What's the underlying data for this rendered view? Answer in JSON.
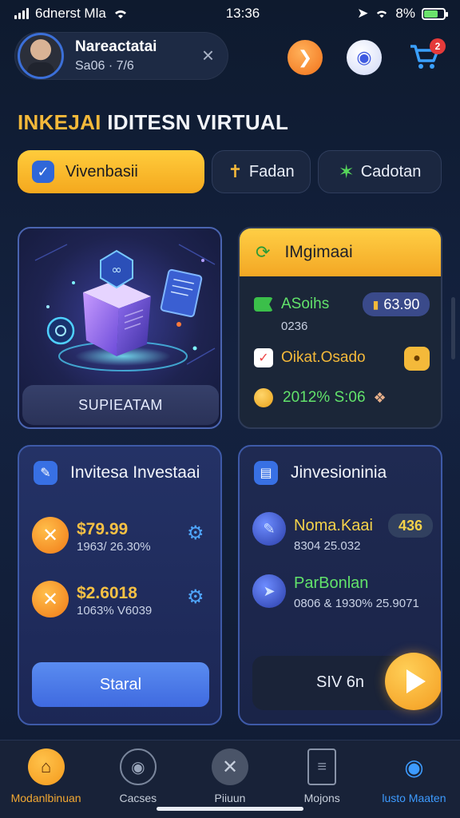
{
  "status_bar": {
    "carrier": "6dnerst Mla",
    "time": "13:36",
    "battery": "8%"
  },
  "header": {
    "profile_name": "Nareactatai",
    "profile_sub": "Sa06 · 7/6",
    "close_symbol": "×",
    "cart_badge": "2"
  },
  "title": {
    "part1": "INKEJAI",
    "part2": "IDITESN VIRTUAL"
  },
  "segments": [
    {
      "label": "Vivenbasii",
      "icon": "check-icon"
    },
    {
      "label": "Fadan",
      "icon": "pin-icon"
    },
    {
      "label": "Cadotan",
      "icon": "star-icon"
    }
  ],
  "vr_card": {
    "button_label": "SUPIEATAM"
  },
  "info_card": {
    "title": "IMgimaai",
    "row1_label": "ASoihs",
    "row1_value": "63.90",
    "row1_sub": "0236",
    "row2_label": "Oikat.Osado",
    "row3_label": "2012% S:06"
  },
  "invest_left": {
    "title": "Invitesa Investaai",
    "item1_amount": "$79.99",
    "item1_sub": "1963/ 26.30%",
    "item2_amount": "$2.6018",
    "item2_sub": "1063% V6039",
    "start_label": "Staral"
  },
  "invest_right": {
    "title": "Jinvesioninia",
    "item1_name": "Noma.Kaai",
    "item1_badge": "436",
    "item1_sub": "8304 25.032",
    "item2_name": "ParBonlan",
    "item2_sub": "0806 & 1930% 25.9071",
    "play_label": "SIV 6n"
  },
  "nav": [
    {
      "label": "Modanlbinuan",
      "icon": "home-icon"
    },
    {
      "label": "Cacses",
      "icon": "globe-icon"
    },
    {
      "label": "Piiuun",
      "icon": "close-circle-icon"
    },
    {
      "label": "Mojons",
      "icon": "document-icon"
    },
    {
      "label": "lusto Maaten",
      "icon": "bot-icon"
    }
  ],
  "colors": {
    "accent_yellow": "#f4b93a",
    "accent_blue": "#3d9bff",
    "green_text": "#62e36b",
    "background": "#142240"
  }
}
